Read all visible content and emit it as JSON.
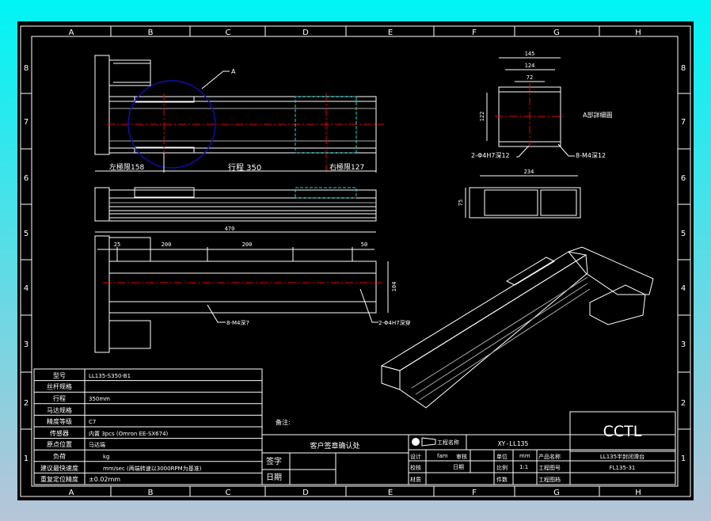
{
  "zones": {
    "columns": [
      "A",
      "B",
      "C",
      "D",
      "E",
      "F",
      "G",
      "H"
    ],
    "rows": [
      "8",
      "7",
      "6",
      "5",
      "4",
      "3",
      "2",
      "1"
    ]
  },
  "top_view": {
    "callout": "A",
    "left_limit": "左極限158",
    "stroke": "行程 350",
    "right_limit": "右極限127"
  },
  "bottom_view": {
    "overall": "470",
    "dims": [
      "25",
      "200",
      "200",
      "50"
    ],
    "height": "104",
    "note_left": "8-M4深7",
    "note_right": "2-Φ4H7深穿"
  },
  "detail": {
    "title": "A部詳細圖",
    "dims": [
      "145",
      "124",
      "72",
      "122"
    ],
    "note_left": "2-Φ4H7深12",
    "note_right": "8-M4深12"
  },
  "end_view": {
    "width": "234",
    "height": "75"
  },
  "spec_table": [
    {
      "label": "型号",
      "value": "LL135-S350-B1"
    },
    {
      "label": "丝杆规格",
      "value": ""
    },
    {
      "label": "行程",
      "value": "350mm"
    },
    {
      "label": "马达规格",
      "value": ""
    },
    {
      "label": "精度等级",
      "value": "C7"
    },
    {
      "label": "传感器",
      "value": "内置 3pcs (Omron EE-SX674)"
    },
    {
      "label": "原点位置",
      "value": "马达端"
    },
    {
      "label": "负荷",
      "value": "kg"
    },
    {
      "label": "建议最快速度",
      "value": "mm/sec (两端转速以3000RPM为基准)"
    },
    {
      "label": "重复定位精度",
      "value": "±0.02mm"
    }
  ],
  "remarks_label": "备注:",
  "customer": {
    "title": "客户签章确认处",
    "sign": "签字",
    "date": "日期"
  },
  "title_block": {
    "logo": "CCTL",
    "project_name_label": "工程名称",
    "project_name": "XY-LL135",
    "design_label": "设计",
    "designer": "fam",
    "review_label": "审核",
    "check_label": "校核",
    "date_label": "日期",
    "material_label": "材质",
    "unit_label": "单位",
    "unit": "mm",
    "scale_label": "比例",
    "scale": "1:1",
    "qty_label": "件数",
    "product_label": "产品名称",
    "product": "LL135半封闭滑台",
    "drawing_no_label": "工程图号",
    "drawing_no": "FL135-31",
    "drawing_file_label": "工程图档"
  },
  "colors": {
    "background": "#000000",
    "frame": "#00f4f4",
    "centerline": "#e00000",
    "hidden": "#33cccc",
    "detail_circle": "#1010b0"
  }
}
